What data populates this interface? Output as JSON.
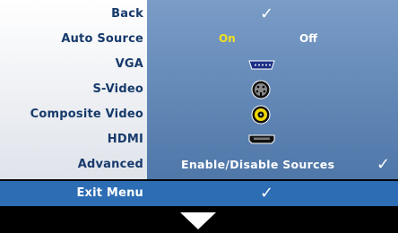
{
  "menu": {
    "items": [
      {
        "label": "Back",
        "value_type": "check"
      },
      {
        "label": "Auto Source",
        "option_on": "On",
        "option_off": "Off",
        "selected": "On"
      },
      {
        "label": "VGA",
        "icon": "vga-connector-icon"
      },
      {
        "label": "S-Video",
        "icon": "svideo-connector-icon"
      },
      {
        "label": "Composite Video",
        "icon": "composite-video-connector-icon"
      },
      {
        "label": "HDMI",
        "icon": "hdmi-connector-icon"
      },
      {
        "label": "Advanced",
        "value": "Enable/Disable Sources",
        "value_type": "check"
      }
    ],
    "exit": {
      "label": "Exit Menu",
      "value_type": "check"
    },
    "scroll_down_icon": "down-arrow-icon"
  },
  "colors": {
    "label_text": "#173a6b",
    "value_panel": "#5f86b8",
    "selected_row": "#2c6db4",
    "on_text": "#f0e020"
  }
}
